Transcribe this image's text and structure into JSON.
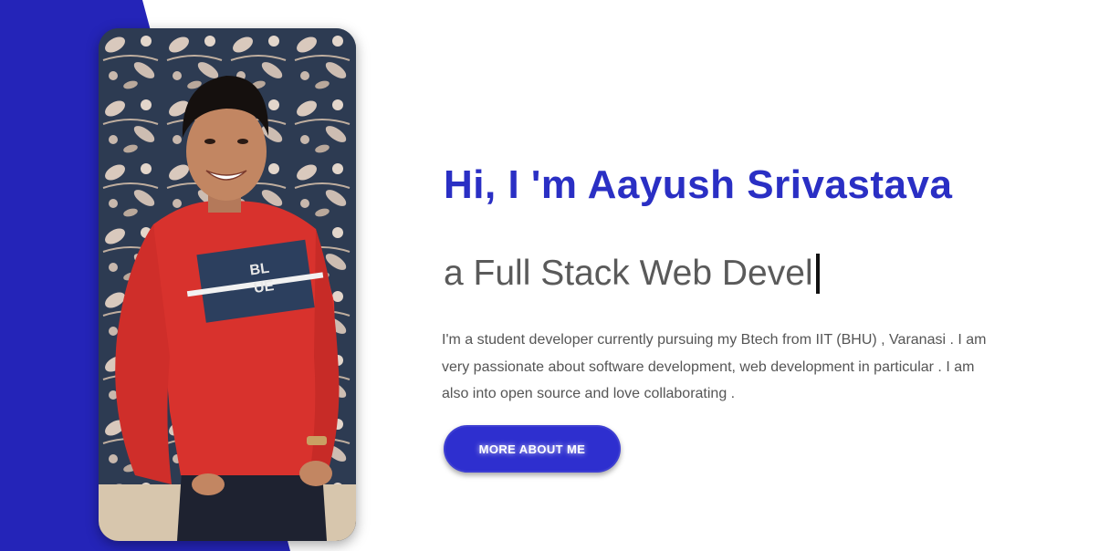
{
  "hero": {
    "greeting": "Hi, I 'm Aayush Srivastava",
    "role_typed": "a Full Stack Web Devel",
    "bio": "I'm a student developer currently pursuing my Btech from IIT (BHU) , Varanasi . I am very passionate about software development, web development in particular . I am also into open source and love collaborating .",
    "cta_label": "MORE ABOUT ME"
  },
  "photo": {
    "shirt_print": [
      "BL",
      "UE"
    ]
  },
  "colors": {
    "accent": "#2a2fc4",
    "side_panel": "#2424b8",
    "button": "#2e2fcf",
    "text_muted": "#5a5a5a",
    "shirt": "#d8322d"
  }
}
